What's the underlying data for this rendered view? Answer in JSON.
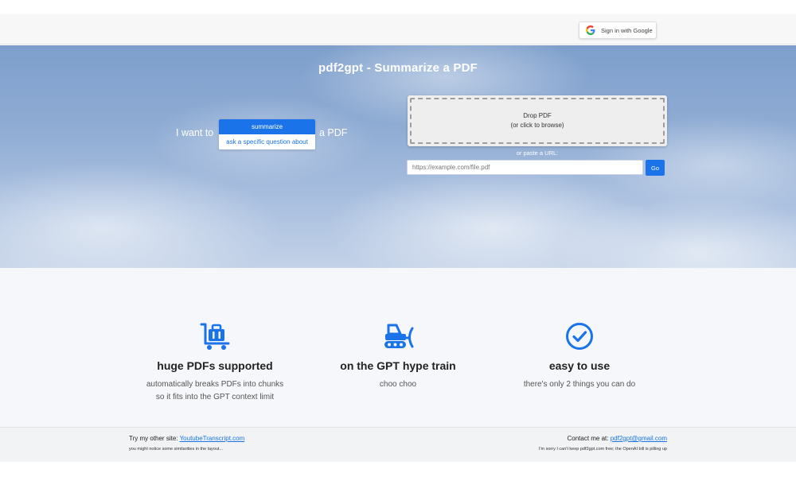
{
  "header": {
    "signin_label": "Sign in with Google",
    "google_colors": [
      "#4285F4",
      "#EA4335",
      "#FBBC05",
      "#34A853"
    ]
  },
  "hero": {
    "title": "pdf2gpt - Summarize a PDF",
    "i_want_to": "I want to",
    "a_pdf": "a PDF",
    "options": [
      "summarize",
      "ask a specific question about"
    ],
    "selected_option": "summarize",
    "dropzone": {
      "line1": "Drop PDF",
      "line2": "(or click to browse)"
    },
    "or_paste": "or paste a URL:",
    "url_placeholder": "https://example.com/file.pdf",
    "go_label": "Go"
  },
  "features": [
    {
      "icon": "luggage-cart-icon",
      "title": "huge PDFs supported",
      "desc": "automatically breaks PDFs into chunks so it fits into the GPT context limit"
    },
    {
      "icon": "snowplow-train-icon",
      "title": "on the GPT hype train",
      "desc": "choo choo"
    },
    {
      "icon": "check-circle-icon",
      "title": "easy to use",
      "desc": "there's only 2 things you can do"
    }
  ],
  "footer": {
    "left_prefix": "Try my other site:",
    "left_link": "YoutubeTranscript.com",
    "left_note": "you might notice some similarities in the layout...",
    "right_prefix": "Contact me at:",
    "right_link": "pdf2gpt@gmail.com",
    "right_note": "I'm sorry I can't keep pdf2gpt.com free; the OpenAI bill is pilling up"
  },
  "colors": {
    "accent": "#1a73e8"
  }
}
